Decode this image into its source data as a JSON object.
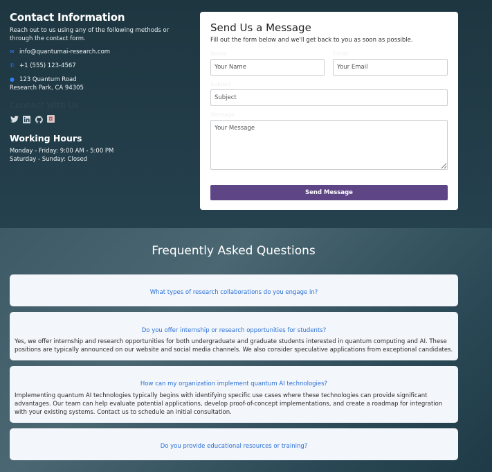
{
  "contact": {
    "title": "Contact Information",
    "description": "Reach out to us using any of the following methods or through the contact form.",
    "email": "info@quantumai-research.com",
    "phone": "+1 (555) 123-4567",
    "address_line1": "123 Quantum Road",
    "address_line2": "Research Park, CA 94305",
    "connect_title": "Connect With Us",
    "social": [
      "twitter-icon",
      "linkedin-icon",
      "github-icon",
      "instagram-icon"
    ],
    "hours_title": "Working Hours",
    "hours": [
      "Monday - Friday: 9:00 AM - 5:00 PM",
      "Saturday - Sunday: Closed"
    ]
  },
  "form": {
    "title": "Send Us a Message",
    "subtitle": "Fill out the form below and we'll get back to you as soon as possible.",
    "name_label": "Name",
    "name_placeholder": "Your Name",
    "email_label": "Email",
    "email_placeholder": "Your Email",
    "subject_label": "Subject",
    "subject_placeholder": "Subject",
    "message_label": "Message",
    "message_placeholder": "Your Message",
    "submit_label": "Send Message"
  },
  "faq": {
    "title": "Frequently Asked Questions",
    "items": [
      {
        "question": "What types of research collaborations do you engage in?",
        "answer": ""
      },
      {
        "question": "Do you offer internship or research opportunities for students?",
        "answer": "Yes, we offer internship and research opportunities for both undergraduate and graduate students interested in quantum computing and AI. These positions are typically announced on our website and social media channels. We also consider speculative applications from exceptional candidates."
      },
      {
        "question": "How can my organization implement quantum AI technologies?",
        "answer": "Implementing quantum AI technologies typically begins with identifying specific use cases where these technologies can provide significant advantages. Our team can help evaluate potential applications, develop proof-of-concept implementations, and create a roadmap for integration with your existing systems. Contact us to schedule an initial consultation."
      },
      {
        "question": "Do you provide educational resources or training?",
        "answer": ""
      }
    ]
  },
  "colors": {
    "accent": "#5e4585",
    "link": "#2a6fd6",
    "icon_blue": "#2f7cf6"
  }
}
